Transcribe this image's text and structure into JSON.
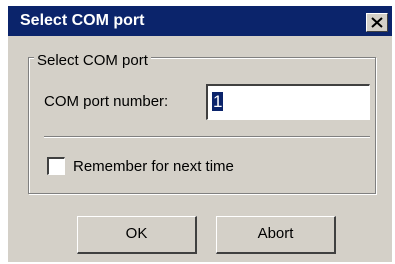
{
  "window": {
    "title": "Select COM port"
  },
  "group": {
    "title": "Select COM port",
    "com_port_label": "COM port number:",
    "com_port_value": "1"
  },
  "options": {
    "remember_label": "Remember for next time",
    "remember_checked": false
  },
  "buttons": {
    "ok_label": "OK",
    "abort_label": "Abort"
  },
  "colors": {
    "titlebar": "#0b246b",
    "dialog_face": "#d4d0c8"
  },
  "icons": {
    "close": "close-icon"
  }
}
